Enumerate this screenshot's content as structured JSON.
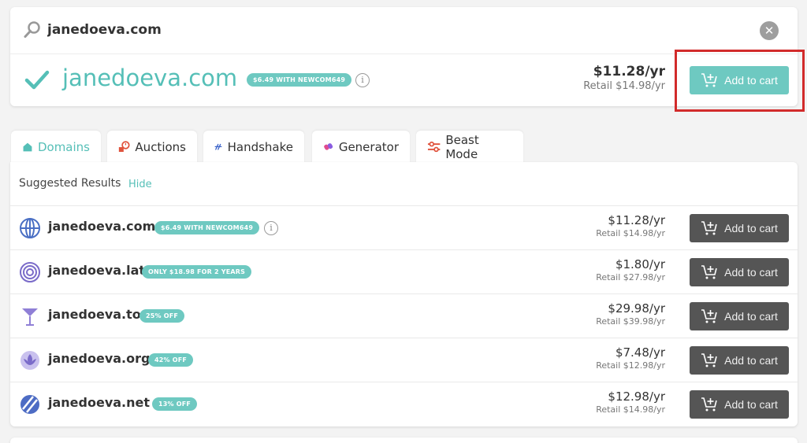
{
  "search": {
    "query": "janedoeva.com"
  },
  "main_result": {
    "domain": "janedoeva.com",
    "promo": "$6.49 WITH NEWCOM649",
    "price": "$11.28/yr",
    "retail": "Retail $14.98/yr",
    "add_label": "Add to cart"
  },
  "tabs": [
    {
      "label": "Domains",
      "icon": "house-icon"
    },
    {
      "label": "Auctions",
      "icon": "auction-clock-icon"
    },
    {
      "label": "Handshake",
      "icon": "handshake-icon"
    },
    {
      "label": "Generator",
      "icon": "generator-icon"
    },
    {
      "label": "Beast Mode",
      "icon": "sliders-icon"
    }
  ],
  "results_header": {
    "title": "Suggested Results",
    "hide_label": "Hide"
  },
  "results": [
    {
      "domain": "janedoeva.com",
      "badge": "$6.49 WITH NEWCOM649",
      "price": "$11.28/yr",
      "retail": "Retail $14.98/yr",
      "add_label": "Add to cart",
      "icon": "globe-icon",
      "has_info": true
    },
    {
      "domain": "janedoeva.lat",
      "badge": "ONLY $18.98 FOR 2 YEARS",
      "price": "$1.80/yr",
      "retail": "Retail $27.98/yr",
      "add_label": "Add to cart",
      "icon": "target-rings-icon",
      "has_info": false
    },
    {
      "domain": "janedoeva.to",
      "badge": "25% OFF",
      "price": "$29.98/yr",
      "retail": "Retail $39.98/yr",
      "add_label": "Add to cart",
      "icon": "cocktail-icon",
      "has_info": false
    },
    {
      "domain": "janedoeva.org",
      "badge": "42% OFF",
      "price": "$7.48/yr",
      "retail": "Retail $12.98/yr",
      "add_label": "Add to cart",
      "icon": "lotus-icon",
      "has_info": false
    },
    {
      "domain": "janedoeva.net",
      "badge": "13% OFF",
      "price": "$12.98/yr",
      "retail": "Retail $14.98/yr",
      "add_label": "Add to cart",
      "icon": "stripes-circle-icon",
      "has_info": false
    }
  ],
  "colors": {
    "teal": "#6ec9c1",
    "teal_text": "#55bfb7",
    "dark_button": "#555555",
    "highlight": "#d22b2b"
  }
}
